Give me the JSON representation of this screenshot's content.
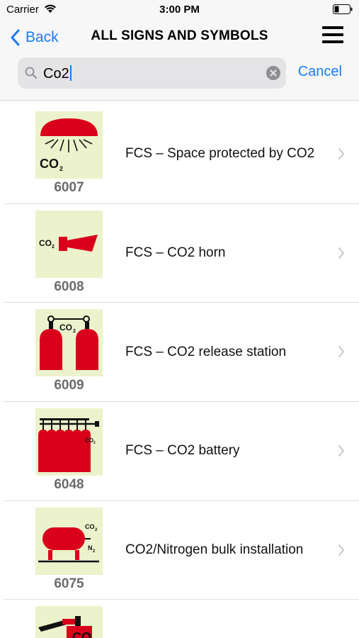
{
  "status_bar": {
    "carrier": "Carrier",
    "time": "3:00 PM"
  },
  "navbar": {
    "back_label": "Back",
    "title": "ALL SIGNS AND SYMBOLS"
  },
  "search": {
    "query": "Co2",
    "cancel_label": "Cancel"
  },
  "items": [
    {
      "code": "6007",
      "label": "FCS – Space protected by CO2",
      "icon": "space-protected-co2-icon"
    },
    {
      "code": "6008",
      "label": "FCS – CO2 horn",
      "icon": "co2-horn-icon"
    },
    {
      "code": "6009",
      "label": "FCS – CO2 release station",
      "icon": "co2-release-station-icon"
    },
    {
      "code": "6048",
      "label": "FCS – CO2 battery",
      "icon": "co2-battery-icon"
    },
    {
      "code": "6075",
      "label": "CO2/Nitrogen bulk installation",
      "icon": "co2-nitrogen-bulk-icon"
    },
    {
      "code": "",
      "label": "",
      "icon": "co2-extinguisher-icon"
    }
  ],
  "colors": {
    "accent": "#1a7cf5",
    "sign_red": "#d9001b",
    "sign_bg": "#ecf3cc",
    "code_gray": "#6b6b6b"
  }
}
